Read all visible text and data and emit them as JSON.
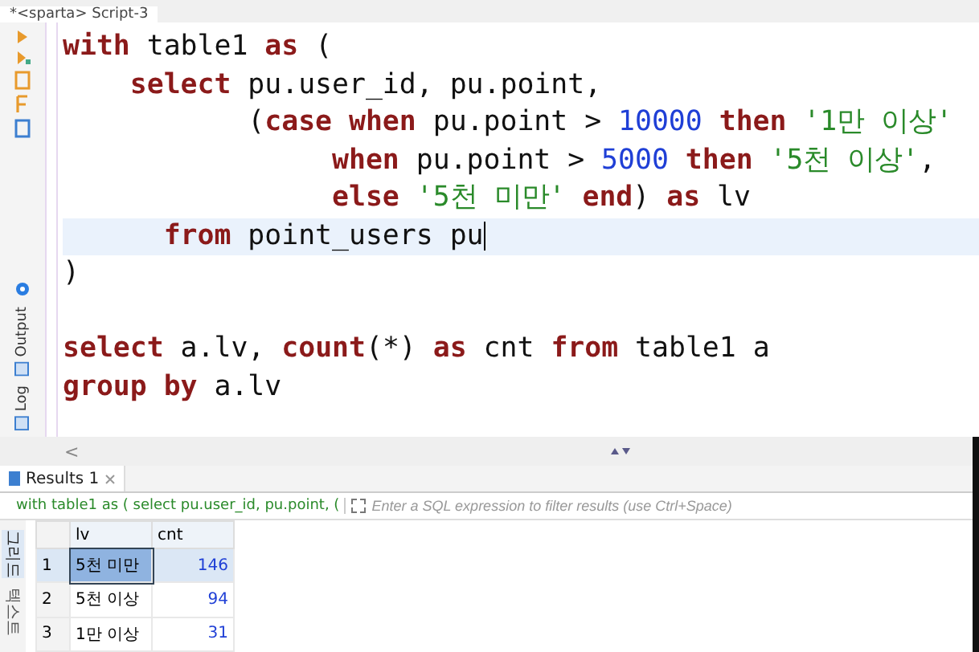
{
  "editor_tab": {
    "title": "*<sparta> Script-3"
  },
  "code_lines": [
    {
      "current": false,
      "tokens": [
        {
          "kind": "keyword",
          "text": "with"
        },
        {
          "kind": "plain",
          "text": " table1 "
        },
        {
          "kind": "keyword",
          "text": "as"
        },
        {
          "kind": "plain",
          "text": " ("
        }
      ]
    },
    {
      "current": false,
      "tokens": [
        {
          "kind": "keyword",
          "text": "    select"
        },
        {
          "kind": "plain",
          "text": " pu.user_id, pu.point,"
        }
      ]
    },
    {
      "current": false,
      "tokens": [
        {
          "kind": "plain",
          "text": "           ("
        },
        {
          "kind": "keyword",
          "text": "case when"
        },
        {
          "kind": "plain",
          "text": " pu.point > "
        },
        {
          "kind": "number",
          "text": "10000"
        },
        {
          "kind": "keyword",
          "text": " then"
        },
        {
          "kind": "string",
          "text": " '1만 이상'"
        }
      ]
    },
    {
      "current": false,
      "tokens": [
        {
          "kind": "keyword",
          "text": "                when"
        },
        {
          "kind": "plain",
          "text": " pu.point > "
        },
        {
          "kind": "number",
          "text": "5000"
        },
        {
          "kind": "keyword",
          "text": " then"
        },
        {
          "kind": "string",
          "text": " '5천 이상'"
        },
        {
          "kind": "plain",
          "text": ","
        }
      ]
    },
    {
      "current": false,
      "tokens": [
        {
          "kind": "keyword",
          "text": "                else"
        },
        {
          "kind": "string",
          "text": " '5천 미만'"
        },
        {
          "kind": "keyword",
          "text": " end"
        },
        {
          "kind": "plain",
          "text": ") "
        },
        {
          "kind": "keyword",
          "text": "as"
        },
        {
          "kind": "plain",
          "text": " lv"
        }
      ]
    },
    {
      "current": true,
      "tokens": [
        {
          "kind": "keyword",
          "text": "      from"
        },
        {
          "kind": "plain",
          "text": " point_users pu"
        }
      ]
    },
    {
      "current": false,
      "tokens": [
        {
          "kind": "plain",
          "text": ")"
        }
      ]
    },
    {
      "current": false
    },
    {
      "current": false,
      "tokens": [
        {
          "kind": "keyword",
          "text": "select"
        },
        {
          "kind": "plain",
          "text": " a.lv, "
        },
        {
          "kind": "keyword",
          "text": "count"
        },
        {
          "kind": "plain",
          "text": "(*) "
        },
        {
          "kind": "keyword",
          "text": "as"
        },
        {
          "kind": "plain",
          "text": " cnt "
        },
        {
          "kind": "keyword",
          "text": "from"
        },
        {
          "kind": "plain",
          "text": " table1 a"
        }
      ]
    },
    {
      "current": false,
      "tokens": [
        {
          "kind": "keyword",
          "text": "group by"
        },
        {
          "kind": "plain",
          "text": " a.lv"
        }
      ]
    }
  ],
  "side_tabs": [
    {
      "label": "Output"
    },
    {
      "label": "Log"
    }
  ],
  "scroll_left": "<",
  "results_tab": {
    "title": "Results 1"
  },
  "filter": {
    "query": "with table1 as ( select pu.user_id, pu.point, (",
    "placeholder": "Enter a SQL expression to filter results (use Ctrl+Space)"
  },
  "view_tabs": [
    {
      "label": "그리드",
      "selected": true
    },
    {
      "label": "텍스트",
      "selected": false
    }
  ],
  "table": {
    "columns": [
      "lv",
      "cnt"
    ],
    "rows": [
      {
        "index": "1",
        "cells": [
          "5천 미만",
          "146"
        ],
        "selected": true
      },
      {
        "index": "2",
        "cells": [
          "5천 이상",
          "94"
        ],
        "selected": false
      },
      {
        "index": "3",
        "cells": [
          "1만 이상",
          "31"
        ],
        "selected": false
      }
    ]
  }
}
